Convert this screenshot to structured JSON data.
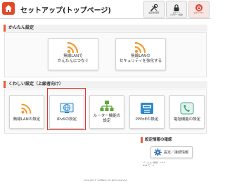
{
  "header": {
    "title": "セットアップ(トップページ)",
    "buttons": [
      {
        "label": "設定を保存",
        "icon": "tools-icon"
      },
      {
        "label": "ログイン\nパスワード変更",
        "icon": "lock-icon"
      },
      {
        "label": "ログアウト",
        "icon": "power-icon"
      }
    ]
  },
  "easy_settings": {
    "heading": "かんたん設定",
    "cards": [
      {
        "label": "無線LANで\nかんたんにつなぐ",
        "icon": "wifi-icon"
      },
      {
        "label": "無線LANの\nセキュリティを強化する",
        "icon": "wifi-icon"
      }
    ]
  },
  "detailed_settings": {
    "heading": "くわしい設定（上級者向け）",
    "cards": [
      {
        "label": "無線LANの設定",
        "icon": "wifi-icon"
      },
      {
        "label": "IPv6の設定",
        "icon": "globe-icon"
      },
      {
        "label": "ルーター機能の\n設定",
        "icon": "network-icon"
      },
      {
        "label": "PPPoEの設定",
        "icon": "pppoe-icon"
      },
      {
        "label": "電話機能の設定",
        "icon": "phone-icon"
      }
    ]
  },
  "info": {
    "heading": "設定情報の確認",
    "button_label": "設定／接続情報",
    "version_line1": "バージョン情報：1.0.2",
    "version_line2": "IPv6 モード"
  },
  "footer": {
    "copyright": "Copyright © SoftBank All rights reserved."
  },
  "colors": {
    "accent": "#e85a3a",
    "highlight": "#e4322b",
    "wifi": "#f29a2e",
    "network": "#5fa83a",
    "pppoe": "#2d88c9",
    "phone": "#4aa88a"
  }
}
